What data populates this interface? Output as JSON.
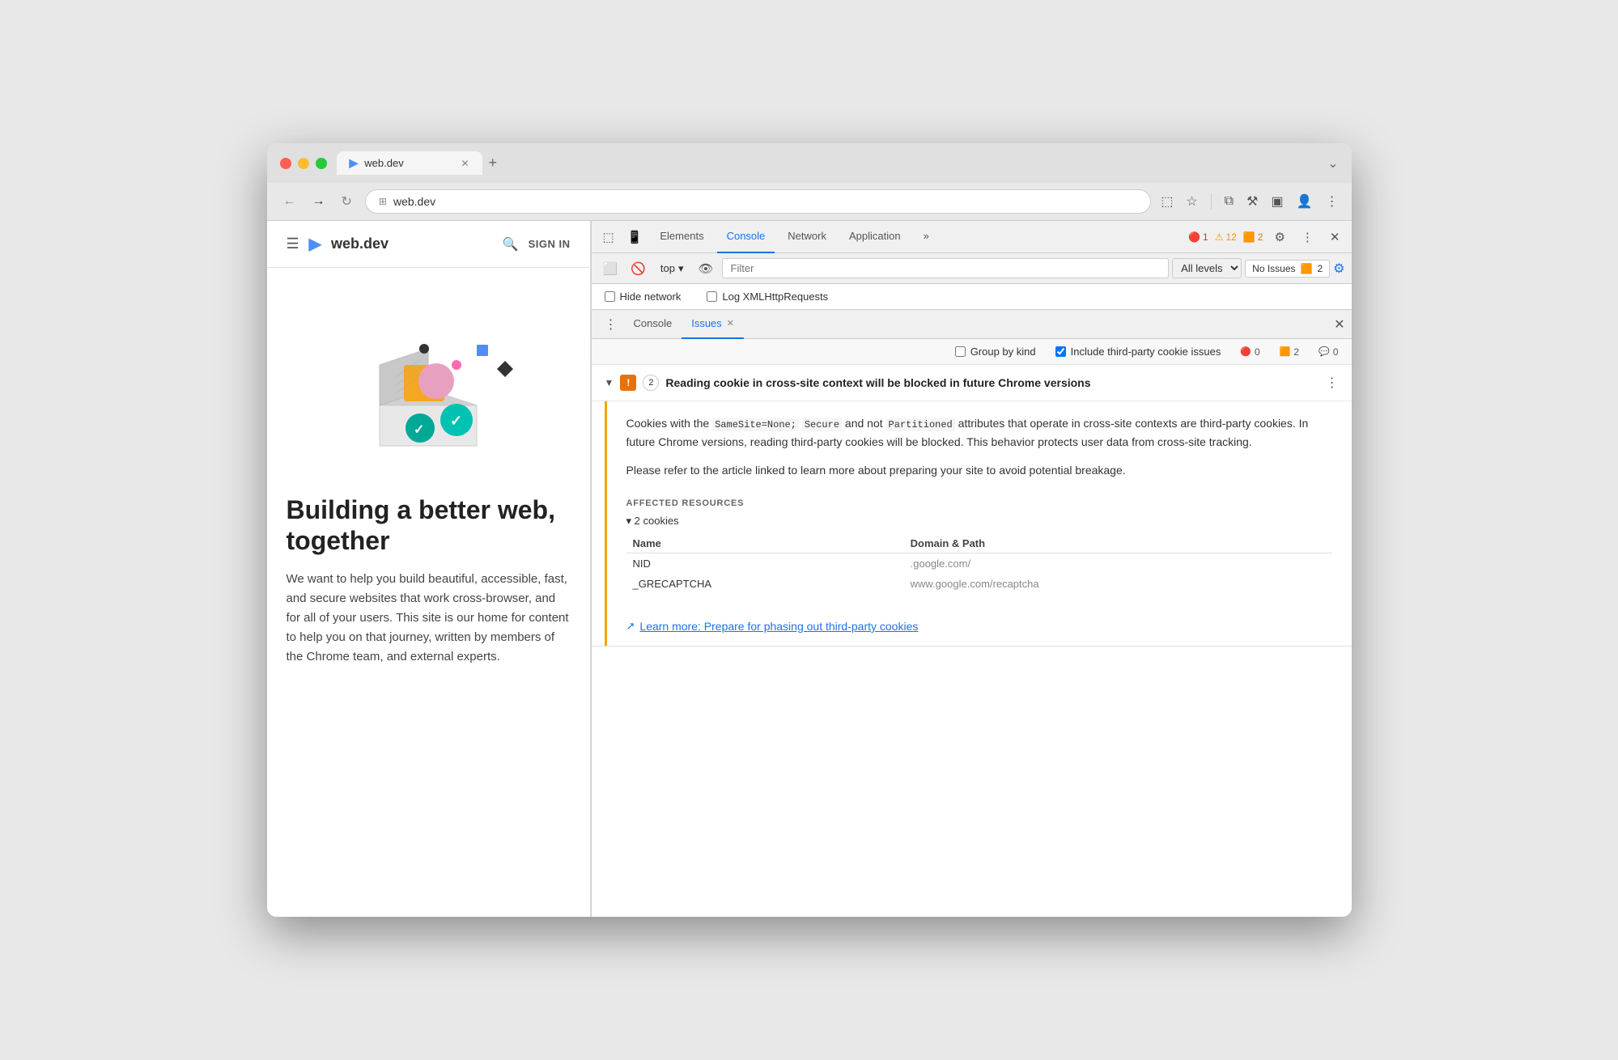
{
  "browser": {
    "tab_title": "web.dev",
    "tab_favicon": "▶",
    "address": "web.dev",
    "address_icon": "⊞",
    "new_tab_icon": "+",
    "window_expand": "⌄"
  },
  "website": {
    "name": "web.dev",
    "logo_icon": "▶",
    "hamburger_icon": "☰",
    "search_icon": "🔍",
    "sign_in": "SIGN IN",
    "heading": "Building a better web, together",
    "description": "We want to help you build beautiful, accessible, fast, and secure websites that work cross-browser, and for all of your users. This site is our home for content to help you on that journey, written by members of the Chrome team, and external experts."
  },
  "devtools": {
    "tabs": [
      {
        "label": "Elements",
        "active": false
      },
      {
        "label": "Console",
        "active": true
      },
      {
        "label": "Network",
        "active": false
      },
      {
        "label": "Application",
        "active": false
      },
      {
        "label": "»",
        "active": false
      }
    ],
    "error_count": "1",
    "warning_count": "12",
    "orange_count": "2",
    "context_label": "top",
    "filter_placeholder": "Filter",
    "levels_label": "All levels",
    "no_issues_label": "No Issues",
    "no_issues_count": "2",
    "hide_network_label": "Hide network",
    "log_xhr_label": "Log XMLHttpRequests",
    "issues_sub_tabs": [
      "Console",
      "Issues"
    ],
    "active_sub_tab": "Issues",
    "group_by_kind_label": "Group by kind",
    "include_third_party_label": "Include third-party cookie issues"
  },
  "issue": {
    "count": "2",
    "title": "Reading cookie in cross-site context will be blocked in future Chrome versions",
    "description_p1": "Cookies with the SameSite=None; Secure and not Partitioned attributes that operate in cross-site contexts are third-party cookies. In future Chrome versions, reading third-party cookies will be blocked. This behavior protects user data from cross-site tracking.",
    "description_p2": "Please refer to the article linked to learn more about preparing your site to avoid potential breakage.",
    "affected_resources_label": "AFFECTED RESOURCES",
    "cookies_toggle_label": "▾ 2 cookies",
    "table_headers": [
      "Name",
      "Domain & Path"
    ],
    "cookies": [
      {
        "name": "NID",
        "domain": ".google.com/"
      },
      {
        "name": "_GRECAPTCHA",
        "domain": "www.google.com/recaptcha"
      }
    ],
    "learn_more_label": "Learn more: Prepare for phasing out third-party cookies"
  },
  "badges": {
    "red_count": "0",
    "orange_count": "2",
    "blue_count": "0"
  }
}
